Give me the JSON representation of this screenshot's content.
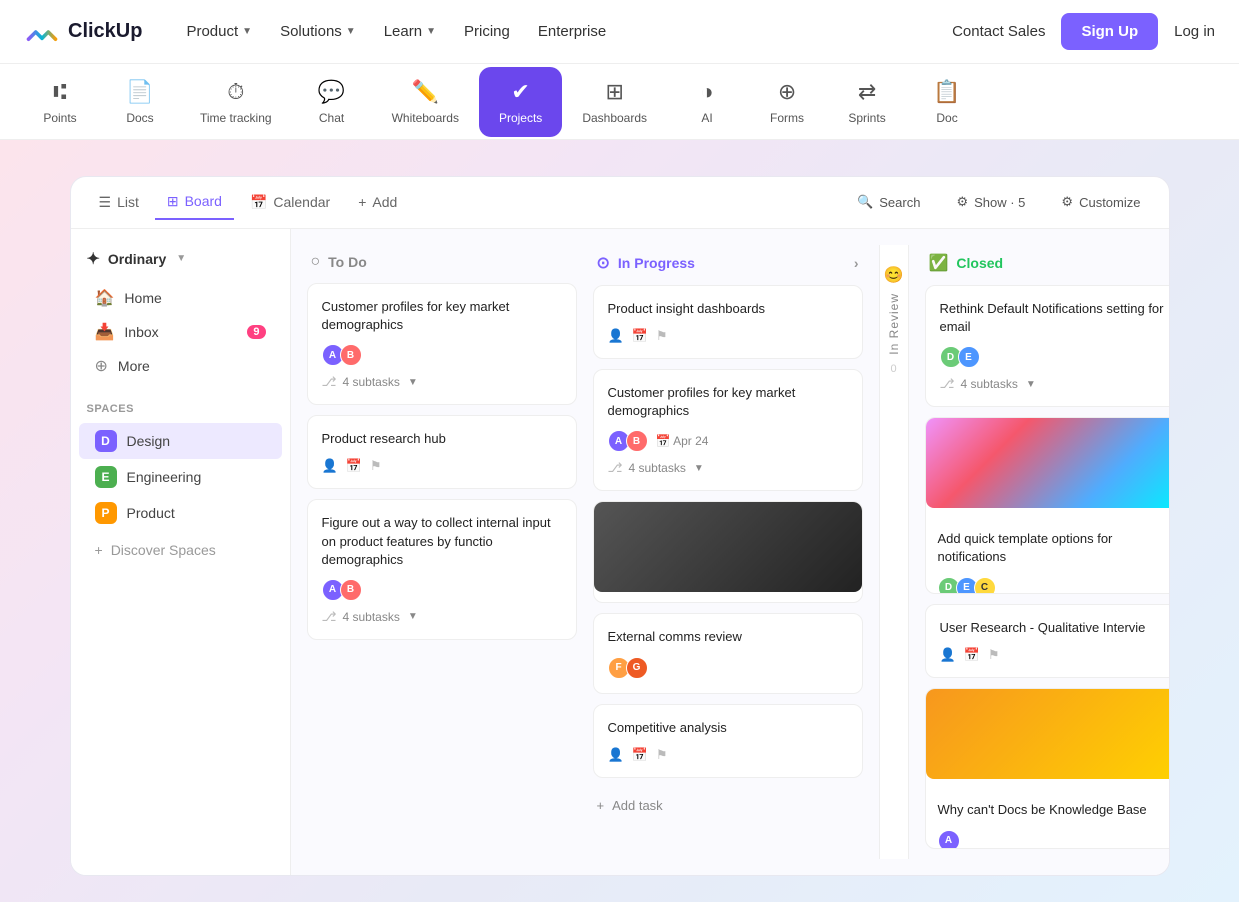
{
  "nav": {
    "logo_text": "ClickUp",
    "links": [
      {
        "label": "Product",
        "has_chevron": true
      },
      {
        "label": "Solutions",
        "has_chevron": true
      },
      {
        "label": "Learn",
        "has_chevron": true
      },
      {
        "label": "Pricing",
        "has_chevron": false
      },
      {
        "label": "Enterprise",
        "has_chevron": false
      }
    ],
    "contact_sales": "Contact Sales",
    "sign_up": "Sign Up",
    "login": "Log in"
  },
  "features": [
    {
      "id": "points",
      "icon": "⑆",
      "label": "Points",
      "active": false
    },
    {
      "id": "docs",
      "icon": "📄",
      "label": "Docs",
      "active": false
    },
    {
      "id": "time",
      "icon": "⏱",
      "label": "Time tracking",
      "active": false
    },
    {
      "id": "chat",
      "icon": "💬",
      "label": "Chat",
      "active": false
    },
    {
      "id": "whiteboards",
      "icon": "✏️",
      "label": "Whiteboards",
      "active": false
    },
    {
      "id": "projects",
      "icon": "✔",
      "label": "Projects",
      "active": true
    },
    {
      "id": "dashboards",
      "icon": "⬜",
      "label": "Dashboards",
      "active": false
    },
    {
      "id": "ai",
      "icon": "◑",
      "label": "AI",
      "active": false
    },
    {
      "id": "forms",
      "icon": "⊕",
      "label": "Forms",
      "active": false
    },
    {
      "id": "sprints",
      "icon": "⇄",
      "label": "Sprints",
      "active": false
    },
    {
      "id": "docs2",
      "icon": "📋",
      "label": "Docs",
      "active": false
    }
  ],
  "workspace": {
    "name": "Ordinary"
  },
  "sidebar": {
    "nav_items": [
      {
        "id": "home",
        "icon": "🏠",
        "label": "Home",
        "badge": null
      },
      {
        "id": "inbox",
        "icon": "📥",
        "label": "Inbox",
        "badge": "9"
      },
      {
        "id": "more",
        "icon": "⊕",
        "label": "More",
        "badge": null
      }
    ],
    "spaces_label": "Spaces",
    "spaces": [
      {
        "id": "design",
        "letter": "D",
        "label": "Design",
        "color": "design",
        "active": true
      },
      {
        "id": "engineering",
        "letter": "E",
        "label": "Engineering",
        "color": "engineering"
      },
      {
        "id": "product",
        "letter": "P",
        "label": "Product",
        "color": "product"
      }
    ],
    "discover_label": "Discover Spaces"
  },
  "board": {
    "views": [
      {
        "id": "list",
        "icon": "☰",
        "label": "List"
      },
      {
        "id": "board",
        "icon": "⊞",
        "label": "Board",
        "active": true
      },
      {
        "id": "calendar",
        "icon": "📅",
        "label": "Calendar"
      },
      {
        "id": "add",
        "icon": "+",
        "label": "Add"
      }
    ],
    "header_actions": [
      {
        "id": "search",
        "icon": "🔍",
        "label": "Search"
      },
      {
        "id": "show",
        "icon": "⚙",
        "label": "Show · 5"
      },
      {
        "id": "customize",
        "icon": "⚙",
        "label": "Customize"
      }
    ]
  },
  "columns": {
    "todo": {
      "title": "To Do",
      "status": "todo",
      "cards": [
        {
          "id": "card-1",
          "title": "Customer profiles for key market demographics",
          "avatars": [
            "a",
            "b"
          ],
          "subtasks": "4 subtasks",
          "has_meta": false
        },
        {
          "id": "card-2",
          "title": "Product research hub",
          "avatars": [],
          "has_icons": true,
          "subtasks": null
        },
        {
          "id": "card-3",
          "title": "Figure out a way to collect internal input on product features by functio demographics",
          "avatars": [
            "a",
            "b"
          ],
          "subtasks": "4 subtasks",
          "has_meta": false
        }
      ]
    },
    "inprogress": {
      "title": "In Progress",
      "status": "inprogress",
      "cards": [
        {
          "id": "card-ip-1",
          "title": "Product insight dashboards",
          "avatars": [],
          "has_icons": true,
          "subtasks": null,
          "image": null
        },
        {
          "id": "card-ip-2",
          "title": "Customer profiles for key market demographics",
          "avatars": [
            "a",
            "b"
          ],
          "date": "Apr 24",
          "subtasks": "4 subtasks",
          "image": null
        },
        {
          "id": "card-ip-3",
          "title": "",
          "image": "dark",
          "avatars": []
        },
        {
          "id": "card-ip-4",
          "title": "External comms review",
          "avatars": [
            "f",
            "g"
          ],
          "image": null,
          "subtasks": null
        },
        {
          "id": "card-ip-5",
          "title": "Competitive analysis",
          "avatars": [],
          "has_icons": true,
          "image": null
        }
      ],
      "add_task": "+ Add task"
    },
    "inreview": {
      "emoji": "😊",
      "label": "In Review",
      "count": "0"
    },
    "closed": {
      "title": "Closed",
      "status": "closed",
      "cards": [
        {
          "id": "card-cl-1",
          "title": "Rethink Default Notifications setting for email",
          "avatars": [
            "d",
            "e"
          ],
          "subtasks": "4 subtasks"
        },
        {
          "id": "card-cl-2",
          "title": "Add quick template options for notifications",
          "avatars": [
            "d",
            "e",
            "c"
          ],
          "image": "colorful"
        },
        {
          "id": "card-cl-3",
          "title": "User Research - Qualitative Intervie",
          "avatars": [],
          "has_icons": true
        },
        {
          "id": "card-cl-4",
          "title": "Why can't Docs be Knowledge Base",
          "avatars": [
            "a"
          ],
          "image": "golden"
        }
      ]
    }
  }
}
